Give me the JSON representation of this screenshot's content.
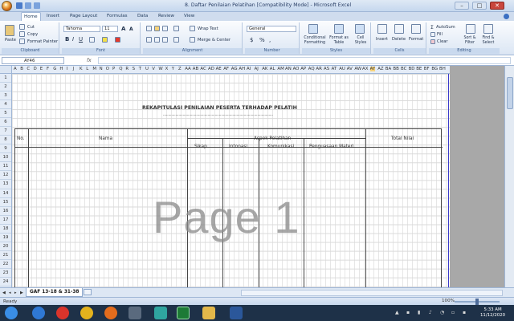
{
  "title_bar": {
    "title": "8. Daftar Penilaian Pelatihan  [Compatibility Mode]  -  Microsoft Excel",
    "minimize": "–",
    "maximize": "□",
    "close": "✕"
  },
  "ribbon_tabs": [
    "Home",
    "Insert",
    "Page Layout",
    "Formulas",
    "Data",
    "Review",
    "View"
  ],
  "ribbon": {
    "clipboard": {
      "paste": "Paste",
      "cut": "Cut",
      "copy": "Copy",
      "format_painter": "Format Painter",
      "label": "Clipboard"
    },
    "font": {
      "font_name": "Tahoma",
      "font_size": "11",
      "bold": "B",
      "italic": "I",
      "underline": "U",
      "grow": "A",
      "shrink": "A",
      "label": "Font"
    },
    "alignment": {
      "wrap_text": "Wrap Text",
      "merge_center": "Merge & Center",
      "label": "Alignment"
    },
    "number": {
      "format": "General",
      "currency": "$",
      "percent": "%",
      "comma": ",",
      "label": "Number"
    },
    "styles": {
      "conditional": "Conditional Formatting",
      "format_table": "Format as Table",
      "cell_styles": "Cell Styles",
      "label": "Styles"
    },
    "cells": {
      "insert": "Insert",
      "delete": "Delete",
      "format": "Format",
      "label": "Cells"
    },
    "editing": {
      "autosum": "AutoSum",
      "fill": "Fill",
      "clear": "Clear",
      "sort_filter": "Sort & Filter",
      "find_select": "Find & Select",
      "label": "Editing"
    }
  },
  "formula_bar": {
    "name_box": "AY46",
    "fx": "fx",
    "formula": ""
  },
  "columns": [
    "A",
    "B",
    "C",
    "D",
    "E",
    "F",
    "G",
    "H",
    "I",
    "J",
    "K",
    "L",
    "M",
    "N",
    "O",
    "P",
    "Q",
    "R",
    "S",
    "T",
    "U",
    "V",
    "W",
    "X",
    "Y",
    "Z",
    "AA",
    "AB",
    "AC",
    "AD",
    "AE",
    "AF",
    "AG",
    "AH",
    "AI",
    "AJ",
    "AK",
    "AL",
    "AM",
    "AN",
    "AO",
    "AP",
    "AQ",
    "AR",
    "AS",
    "AT",
    "AU",
    "AV",
    "AW",
    "AX",
    "AY",
    "AZ",
    "BA",
    "BB",
    "BC",
    "BD",
    "BE",
    "BF",
    "BG",
    "BH"
  ],
  "rows": [
    "1",
    "2",
    "3",
    "4",
    "5",
    "6",
    "7",
    "8",
    "9",
    "10",
    "11",
    "12",
    "13",
    "14",
    "15",
    "16",
    "17",
    "18",
    "19",
    "20",
    "21",
    "22",
    "23",
    "24"
  ],
  "sheet": {
    "title": "REKAPITULASI PENILAIAN PESERTA TERHADAP PELATIH",
    "underline": "..........................................................................................................",
    "headers": {
      "no": "No.",
      "nama": "Nama",
      "aspek": "Aspek Pelatihan",
      "total": "Total Nilai",
      "sub": [
        "Sikap",
        "Intonasi",
        "Komunikasi",
        "Penguasaan Materi"
      ]
    },
    "watermark": "Page 1"
  },
  "sheet_tab": "GAF 13-18 & 31-38",
  "status": {
    "ready": "Ready",
    "zoom": "100%"
  },
  "taskbar": {
    "time": "5:33 AM",
    "date": "11/12/2020"
  },
  "colors": {
    "accent": "#1e395b",
    "ribbon": "#dbe6f4",
    "taskbar": "#1e3148"
  }
}
